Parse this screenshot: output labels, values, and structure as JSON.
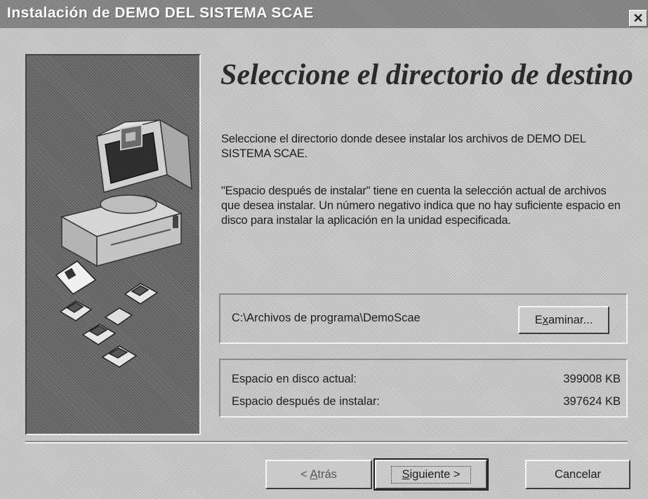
{
  "window": {
    "title": "Instalación de DEMO DEL SISTEMA SCAE",
    "close_glyph": "✕"
  },
  "illustration": {
    "icon": "computer-with-floppy-disks-illustration"
  },
  "content": {
    "heading": "Seleccione el directorio de destino",
    "intro": "Seleccione el directorio donde desee instalar los archivos de DEMO DEL SISTEMA SCAE.",
    "note": "\"Espacio después de instalar\" tiene en cuenta la selección actual de archivos que desea instalar.  Un número negativo indica que no hay suficiente espacio en disco para instalar la aplicación en la unidad especificada."
  },
  "destination": {
    "path": "C:\\Archivos de programa\\DemoScae",
    "browse_label_pre": "E",
    "browse_label_accel": "x",
    "browse_label_post": "aminar..."
  },
  "disk_space": {
    "current_label": "Espacio en disco actual:",
    "current_value": "399008 KB",
    "after_label": "Espacio después de instalar:",
    "after_value": "397624 KB"
  },
  "buttons": {
    "back_pre": "< ",
    "back_accel": "A",
    "back_post": "trás",
    "next_accel": "S",
    "next_post": "iguiente >",
    "cancel": "Cancelar"
  }
}
